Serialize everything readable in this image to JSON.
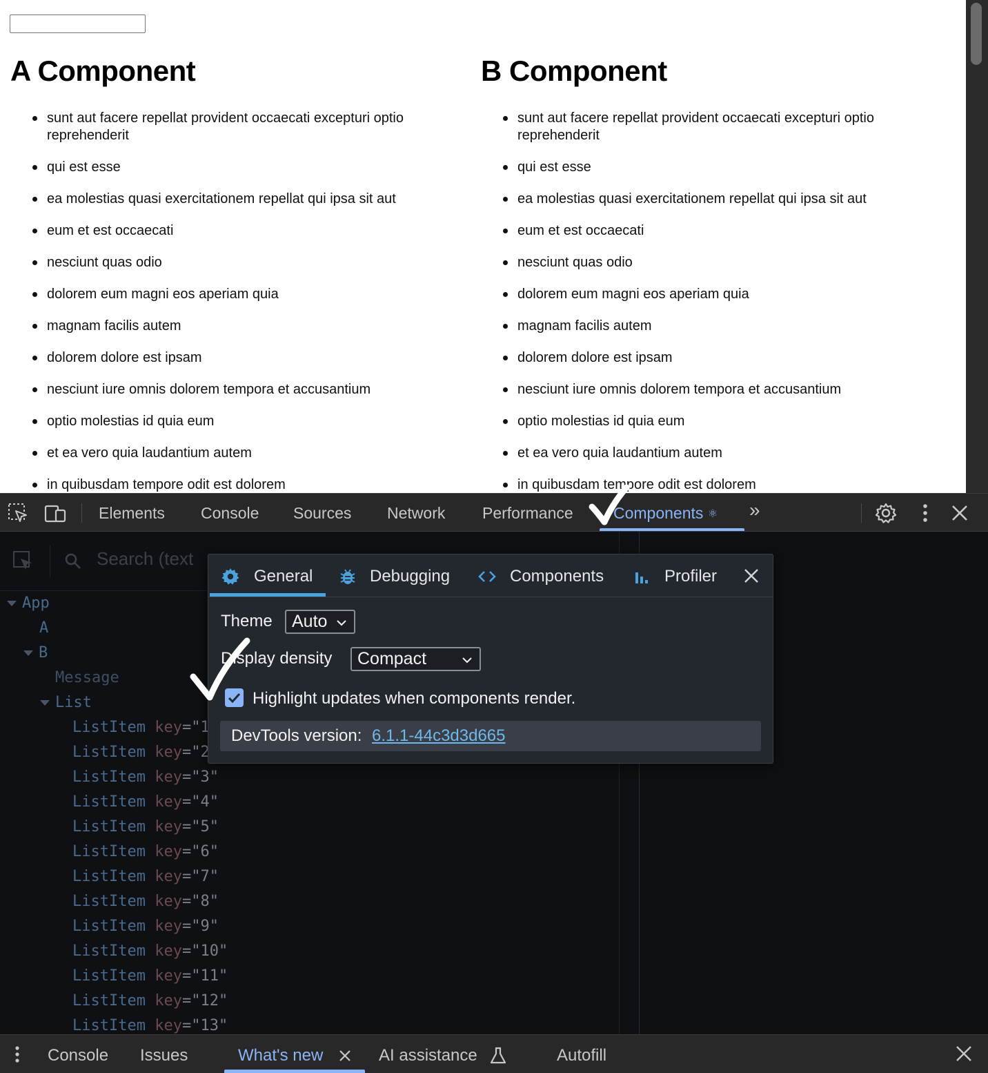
{
  "page": {
    "input_value": "",
    "columns": [
      {
        "heading": "A Component",
        "items": [
          "sunt aut facere repellat provident occaecati excepturi optio reprehenderit",
          "qui est esse",
          "ea molestias quasi exercitationem repellat qui ipsa sit aut",
          "eum et est occaecati",
          "nesciunt quas odio",
          "dolorem eum magni eos aperiam quia",
          "magnam facilis autem",
          "dolorem dolore est ipsam",
          "nesciunt iure omnis dolorem tempora et accusantium",
          "optio molestias id quia eum",
          "et ea vero quia laudantium autem",
          "in quibusdam tempore odit est dolorem"
        ]
      },
      {
        "heading": "B Component",
        "items": [
          "sunt aut facere repellat provident occaecati excepturi optio reprehenderit",
          "qui est esse",
          "ea molestias quasi exercitationem repellat qui ipsa sit aut",
          "eum et est occaecati",
          "nesciunt quas odio",
          "dolorem eum magni eos aperiam quia",
          "magnam facilis autem",
          "dolorem dolore est ipsam",
          "nesciunt iure omnis dolorem tempora et accusantium",
          "optio molestias id quia eum",
          "et ea vero quia laudantium autem",
          "in quibusdam tempore odit est dolorem"
        ]
      }
    ]
  },
  "devtools": {
    "tabs": [
      "Elements",
      "Console",
      "Sources",
      "Network",
      "Performance",
      "Components"
    ],
    "active_tab": "Components",
    "components_tab_badge": "⚛",
    "more_tabs": "»",
    "search_placeholder": "Search (text",
    "tree": {
      "app": "App",
      "a": "A",
      "b": "B",
      "message": "Message",
      "list": "List",
      "list_item": "ListItem",
      "key_attr": "key",
      "keys": [
        "\"1",
        "\"2",
        "\"3\"",
        "\"4\"",
        "\"5\"",
        "\"6\"",
        "\"7\"",
        "\"8\"",
        "\"9\"",
        "\"10\"",
        "\"11\"",
        "\"12\"",
        "\"13\""
      ]
    }
  },
  "settings": {
    "tabs": [
      {
        "label": "General",
        "icon": "gear-icon"
      },
      {
        "label": "Debugging",
        "icon": "bug-icon"
      },
      {
        "label": "Components",
        "icon": "code-icon"
      },
      {
        "label": "Profiler",
        "icon": "bar-chart-icon"
      }
    ],
    "active_tab": "General",
    "theme_label": "Theme",
    "theme_value": "Auto",
    "density_label": "Display density",
    "density_value": "Compact",
    "highlight_label": "Highlight updates when components render.",
    "highlight_checked": true,
    "version_label": "DevTools version:",
    "version_value": "6.1.1-44c3d3d665"
  },
  "drawer": {
    "tabs": [
      "Console",
      "Issues",
      "What's new",
      "AI assistance",
      "Autofill"
    ],
    "active_tab": "What's new"
  },
  "colors": {
    "accent": "#8ab4f8",
    "popup_accent": "#4aa3df",
    "devtools_bg": "#0e1013",
    "popup_bg": "#23272e"
  }
}
